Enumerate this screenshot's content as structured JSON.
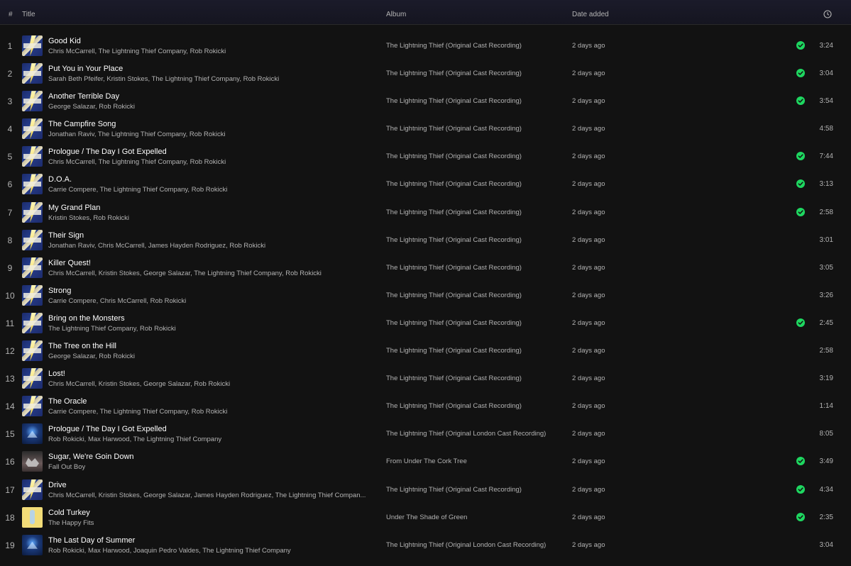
{
  "header": {
    "num": "#",
    "title": "Title",
    "album": "Album",
    "date_added": "Date added",
    "duration_icon": "clock-icon"
  },
  "colors": {
    "saved_check": "#1ed760",
    "background": "#121212"
  },
  "tracks": [
    {
      "num": "1",
      "title": "Good Kid",
      "artists": "Chris McCarrell, The Lightning Thief Company, Rob Rokicki",
      "album": "The Lightning Thief (Original Cast Recording)",
      "date": "2 days ago",
      "saved": true,
      "duration": "3:24",
      "art": "lt"
    },
    {
      "num": "2",
      "title": "Put You in Your Place",
      "artists": "Sarah Beth Pfeifer, Kristin Stokes, The Lightning Thief Company, Rob Rokicki",
      "album": "The Lightning Thief (Original Cast Recording)",
      "date": "2 days ago",
      "saved": true,
      "duration": "3:04",
      "art": "lt"
    },
    {
      "num": "3",
      "title": "Another Terrible Day",
      "artists": "George Salazar, Rob Rokicki",
      "album": "The Lightning Thief (Original Cast Recording)",
      "date": "2 days ago",
      "saved": true,
      "duration": "3:54",
      "art": "lt"
    },
    {
      "num": "4",
      "title": "The Campfire Song",
      "artists": "Jonathan Raviv, The Lightning Thief Company, Rob Rokicki",
      "album": "The Lightning Thief (Original Cast Recording)",
      "date": "2 days ago",
      "saved": false,
      "duration": "4:58",
      "art": "lt"
    },
    {
      "num": "5",
      "title": "Prologue / The Day I Got Expelled",
      "artists": "Chris McCarrell, The Lightning Thief Company, Rob Rokicki",
      "album": "The Lightning Thief (Original Cast Recording)",
      "date": "2 days ago",
      "saved": true,
      "duration": "7:44",
      "art": "lt"
    },
    {
      "num": "6",
      "title": "D.O.A.",
      "artists": "Carrie Compere, The Lightning Thief Company, Rob Rokicki",
      "album": "The Lightning Thief (Original Cast Recording)",
      "date": "2 days ago",
      "saved": true,
      "duration": "3:13",
      "art": "lt"
    },
    {
      "num": "7",
      "title": "My Grand Plan",
      "artists": "Kristin Stokes, Rob Rokicki",
      "album": "The Lightning Thief (Original Cast Recording)",
      "date": "2 days ago",
      "saved": true,
      "duration": "2:58",
      "art": "lt"
    },
    {
      "num": "8",
      "title": "Their Sign",
      "artists": "Jonathan Raviv, Chris McCarrell, James Hayden Rodriguez, Rob Rokicki",
      "album": "The Lightning Thief (Original Cast Recording)",
      "date": "2 days ago",
      "saved": false,
      "duration": "3:01",
      "art": "lt"
    },
    {
      "num": "9",
      "title": "Killer Quest!",
      "artists": "Chris McCarrell, Kristin Stokes, George Salazar, The Lightning Thief Company, Rob Rokicki",
      "album": "The Lightning Thief (Original Cast Recording)",
      "date": "2 days ago",
      "saved": false,
      "duration": "3:05",
      "art": "lt"
    },
    {
      "num": "10",
      "title": "Strong",
      "artists": "Carrie Compere, Chris McCarrell, Rob Rokicki",
      "album": "The Lightning Thief (Original Cast Recording)",
      "date": "2 days ago",
      "saved": false,
      "duration": "3:26",
      "art": "lt"
    },
    {
      "num": "11",
      "title": "Bring on the Monsters",
      "artists": "The Lightning Thief Company, Rob Rokicki",
      "album": "The Lightning Thief (Original Cast Recording)",
      "date": "2 days ago",
      "saved": true,
      "duration": "2:45",
      "art": "lt"
    },
    {
      "num": "12",
      "title": "The Tree on the Hill",
      "artists": "George Salazar, Rob Rokicki",
      "album": "The Lightning Thief (Original Cast Recording)",
      "date": "2 days ago",
      "saved": false,
      "duration": "2:58",
      "art": "lt"
    },
    {
      "num": "13",
      "title": "Lost!",
      "artists": "Chris McCarrell, Kristin Stokes, George Salazar, Rob Rokicki",
      "album": "The Lightning Thief (Original Cast Recording)",
      "date": "2 days ago",
      "saved": false,
      "duration": "3:19",
      "art": "lt"
    },
    {
      "num": "14",
      "title": "The Oracle",
      "artists": "Carrie Compere, The Lightning Thief Company, Rob Rokicki",
      "album": "The Lightning Thief (Original Cast Recording)",
      "date": "2 days ago",
      "saved": false,
      "duration": "1:14",
      "art": "lt"
    },
    {
      "num": "15",
      "title": "Prologue / The Day I Got Expelled",
      "artists": "Rob Rokicki, Max Harwood, The Lightning Thief Company",
      "album": "The Lightning Thief (Original London Cast Recording)",
      "date": "2 days ago",
      "saved": false,
      "duration": "8:05",
      "art": "london"
    },
    {
      "num": "16",
      "title": "Sugar, We're Goin Down",
      "artists": "Fall Out Boy",
      "album": "From Under The Cork Tree",
      "date": "2 days ago",
      "saved": true,
      "duration": "3:49",
      "art": "fob"
    },
    {
      "num": "17",
      "title": "Drive",
      "artists": "Chris McCarrell, Kristin Stokes, George Salazar, James Hayden Rodriguez, The Lightning Thief Compan...",
      "album": "The Lightning Thief (Original Cast Recording)",
      "date": "2 days ago",
      "saved": true,
      "duration": "4:34",
      "art": "lt"
    },
    {
      "num": "18",
      "title": "Cold Turkey",
      "artists": "The Happy Fits",
      "album": "Under The Shade of Green",
      "date": "2 days ago",
      "saved": true,
      "duration": "2:35",
      "art": "hf"
    },
    {
      "num": "19",
      "title": "The Last Day of Summer",
      "artists": "Rob Rokicki, Max Harwood, Joaquin Pedro Valdes, The Lightning Thief Company",
      "album": "The Lightning Thief (Original London Cast Recording)",
      "date": "2 days ago",
      "saved": false,
      "duration": "3:04",
      "art": "london"
    }
  ]
}
